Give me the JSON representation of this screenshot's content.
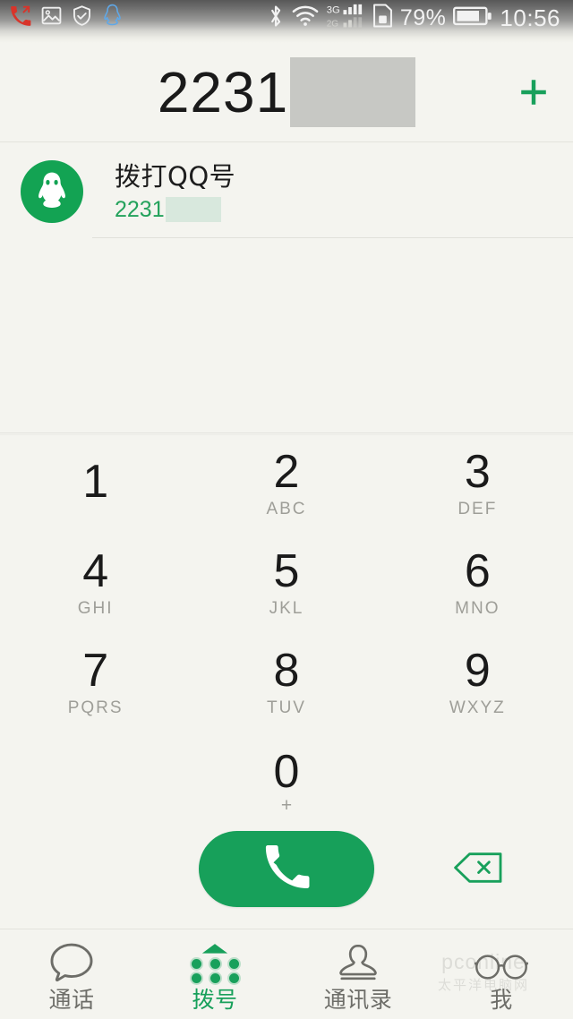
{
  "statusbar": {
    "left_icons": [
      {
        "name": "missed-call-icon",
        "label": "missed-call"
      },
      {
        "name": "screenshot-image-icon",
        "label": "image"
      },
      {
        "name": "shield-check-icon",
        "label": "security"
      },
      {
        "name": "qq-penguin-icon",
        "label": "qq"
      }
    ],
    "right_icons": [
      {
        "name": "bluetooth-icon",
        "label": "bluetooth"
      },
      {
        "name": "wifi-icon",
        "label": "wifi"
      },
      {
        "name": "dual-signal-icon",
        "label": "3G/2G"
      },
      {
        "name": "sim-card-icon",
        "label": "sim"
      }
    ],
    "signal_primary": "3G",
    "signal_secondary": "2G",
    "battery_percent": "79%",
    "time": "10:56"
  },
  "header": {
    "dialed_number": "2231",
    "redacted": true,
    "add_contact_label": "+"
  },
  "suggestion": {
    "avatar_icon": "qq-penguin-avatar",
    "title": "拨打QQ号",
    "subtitle": "2231",
    "subtitle_redacted": true
  },
  "keypad": {
    "rows": [
      [
        {
          "digit": "1",
          "letters": ""
        },
        {
          "digit": "2",
          "letters": "ABC"
        },
        {
          "digit": "3",
          "letters": "DEF"
        }
      ],
      [
        {
          "digit": "4",
          "letters": "GHI"
        },
        {
          "digit": "5",
          "letters": "JKL"
        },
        {
          "digit": "6",
          "letters": "MNO"
        }
      ],
      [
        {
          "digit": "7",
          "letters": "PQRS"
        },
        {
          "digit": "8",
          "letters": "TUV"
        },
        {
          "digit": "9",
          "letters": "WXYZ"
        }
      ],
      [
        {
          "digit": "",
          "letters": ""
        },
        {
          "digit": "0",
          "letters": "+"
        },
        {
          "digit": "",
          "letters": ""
        }
      ]
    ]
  },
  "actions": {
    "call_icon": "phone-handset-icon",
    "delete_icon": "backspace-icon"
  },
  "navbar": {
    "items": [
      {
        "label": "通话",
        "icon": "speech-bubble-icon",
        "active": false
      },
      {
        "label": "拨号",
        "icon": "dialpad-icon",
        "active": true
      },
      {
        "label": "通讯录",
        "icon": "person-icon",
        "active": false
      },
      {
        "label": "我",
        "icon": "glasses-icon",
        "active": false
      }
    ]
  },
  "watermark": {
    "line1": "pconline",
    "line2": "太平洋电脑网"
  },
  "colors": {
    "background": "#f4f4ef",
    "accent_green": "#18a05b",
    "call_button": "#17a05a",
    "avatar_green": "#13a353",
    "text_primary": "#1a1a1a",
    "text_secondary": "#9e9e98",
    "nav_inactive": "#6d6d68",
    "divider": "#e2e2dc",
    "redaction_gray": "#c7c8c4",
    "redaction_green": "#d8e8dd"
  }
}
